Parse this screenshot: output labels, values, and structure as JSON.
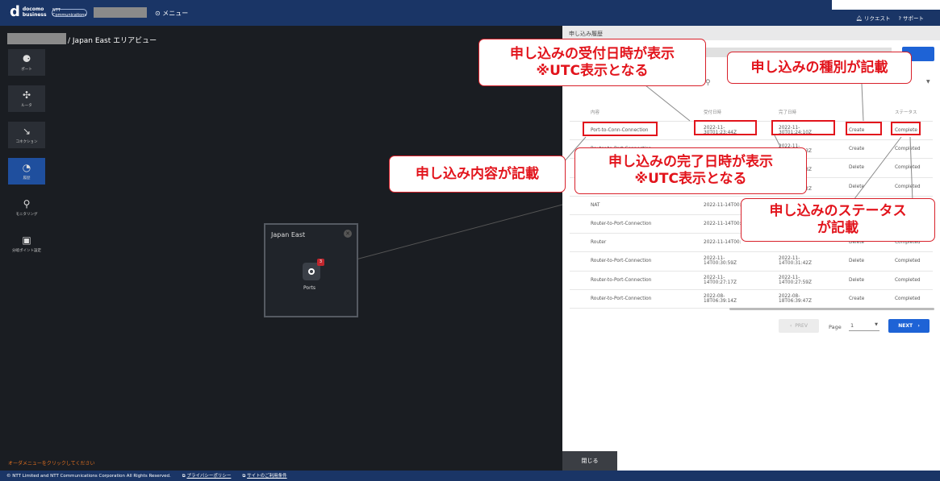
{
  "header": {
    "logo_mark": "d",
    "logo_line1": "docomo",
    "logo_line2": "business",
    "ntt_logo": "NTT Communications",
    "menu": "⊙ メニュー",
    "request": "リクエスト",
    "support": "サポート"
  },
  "breadcrumb": "/ Japan East エリアビュー",
  "sidebar": [
    {
      "icon": "port-icon",
      "glyph": "⚈",
      "label": "ポート"
    },
    {
      "icon": "router-icon",
      "glyph": "✣",
      "label": "ルータ"
    },
    {
      "icon": "connection-icon",
      "glyph": "↘",
      "label": "コネクション"
    },
    {
      "icon": "history-icon",
      "glyph": "◔",
      "label": "履歴"
    },
    {
      "icon": "monitoring-icon",
      "glyph": "⚲",
      "label": "モニタリング"
    },
    {
      "icon": "distribution-point-icon",
      "glyph": "▣",
      "label": "分岐ポイント設定"
    }
  ],
  "order_message": "オーダメニューをクリックしてください",
  "area_card": {
    "title": "Japan East",
    "port_badge": "3",
    "port_label": "Ports"
  },
  "footer": {
    "copyright": "© NTT Limited and NTT Communications Corporation All Rights Reserved.",
    "privacy": "プライバシーポリシー",
    "terms": "サイトのご利用条件"
  },
  "panel": {
    "title": "申し込み履歴",
    "columns": [
      "内容",
      "受付日時",
      "完了日時",
      "",
      "ステータス"
    ],
    "rows": [
      [
        "Port-to-Conn-Connection",
        "2022-11-30T01:23:44Z",
        "2022-11-30T01:24:10Z",
        "Create",
        "Complete"
      ],
      [
        "Router-to-Port-Connection",
        "",
        "2022-11-14T00:49:03Z",
        "Create",
        "Completed"
      ],
      [
        "Router-to-Port-Connection",
        "",
        "2022-11-14T00:45:18Z",
        "Delete",
        "Completed"
      ],
      [
        "Router-to-Port-Connection",
        "",
        "2022-11-14T00:43:22Z",
        "Delete",
        "Completed"
      ],
      [
        "NAT",
        "2022-11-14T00:",
        "",
        "",
        ""
      ],
      [
        "Router-to-Port-Connection",
        "2022-11-14T00:",
        "",
        "",
        ""
      ],
      [
        "Router",
        "2022-11-14T00:",
        "",
        "Delete",
        "Completed"
      ],
      [
        "Router-to-Port-Connection",
        "2022-11-14T00:30:59Z",
        "2022-11-14T00:31:42Z",
        "Delete",
        "Completed"
      ],
      [
        "Router-to-Port-Connection",
        "2022-11-14T00:27:17Z",
        "2022-11-14T00:27:59Z",
        "Delete",
        "Completed"
      ],
      [
        "Router-to-Port-Connection",
        "2022-08-18T06:39:14Z",
        "2022-08-18T06:39:47Z",
        "Create",
        "Completed"
      ]
    ],
    "pager": {
      "prev": "PREV",
      "page_label": "Page",
      "page_value": "1",
      "next": "NEXT"
    },
    "close": "閉じる"
  },
  "annotations": {
    "received": "申し込みの受付日時が表示\n※UTC表示となる",
    "type": "申し込みの種別が記載",
    "completed": "申し込みの完了日時が表示\n※UTC表示となる",
    "content": "申し込み内容が記載",
    "status": "申し込みのステータス\nが記載"
  },
  "colors": {
    "accent": "#1e63d6",
    "annotation_red": "#e2141c",
    "header_bg": "#1a3566"
  }
}
